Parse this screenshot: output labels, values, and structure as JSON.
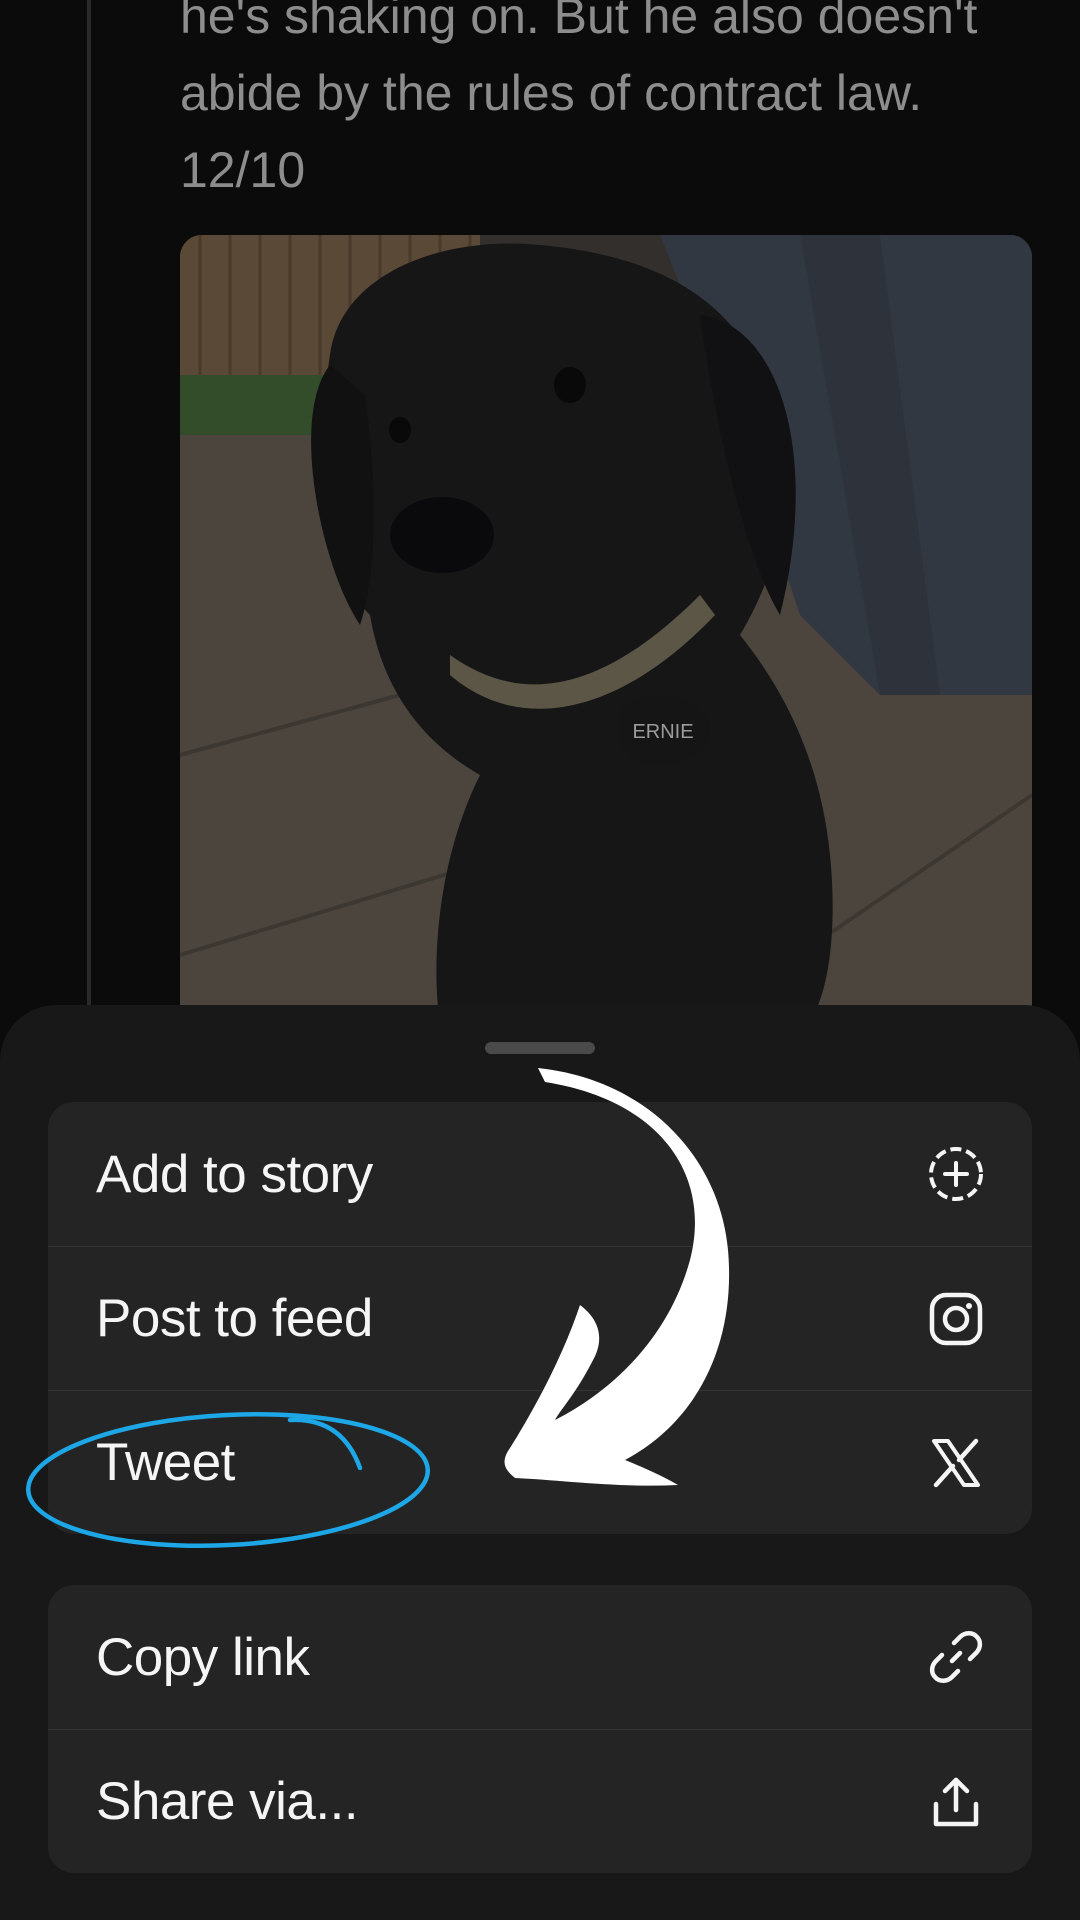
{
  "post": {
    "text_lines": [
      "he's shaking on. But he also doesn't",
      "abide by the rules of contract law.",
      "12/10"
    ],
    "image": {
      "alt": "black labrador puppy",
      "tag_text": "ERNIE"
    }
  },
  "share_sheet": {
    "group_1": [
      {
        "label": "Add to story",
        "icon": "add-story-icon"
      },
      {
        "label": "Post to feed",
        "icon": "instagram-icon"
      },
      {
        "label": "Tweet",
        "icon": "x-logo-icon"
      }
    ],
    "group_2": [
      {
        "label": "Copy link",
        "icon": "link-icon"
      },
      {
        "label": "Share via...",
        "icon": "share-icon"
      }
    ]
  },
  "annotations": {
    "arrow_color": "#ffffff",
    "circle_color": "#1da7e6"
  }
}
